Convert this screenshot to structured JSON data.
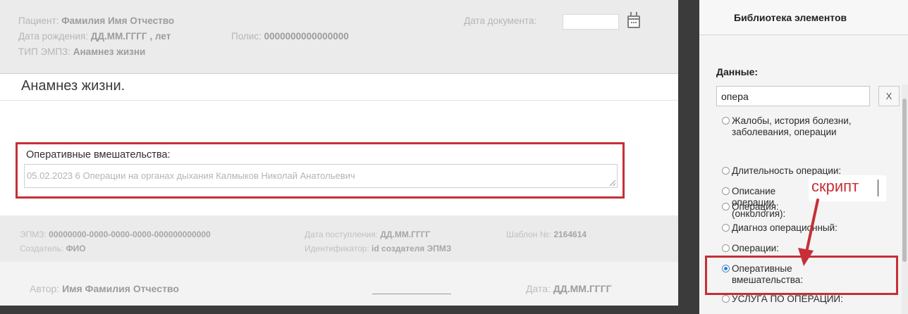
{
  "document": {
    "patient_label": "Пациент:",
    "patient_value": "Фамилия Имя Отчество",
    "birth_label": "Дата рождения:",
    "birth_value": "ДД.ММ.ГГГГ , лет",
    "policy_label": "Полис:",
    "policy_value": "0000000000000000",
    "type_label": "ТИП ЭМПЗ:",
    "type_value": "Анамнез жизни",
    "doc_date_label": "Дата документа:",
    "doc_date_value": "",
    "section_title": "Анамнез жизни.",
    "field_label": "Оперативные вмешательства:",
    "field_value": "05.02.2023 6 Операции на органах дыхания Калмыков Николай Анатольевич"
  },
  "footer": {
    "emz_label": "ЭПМЗ:",
    "emz_value": "00000000-0000-0000-0000-000000000000",
    "creator_label": "Создатель:",
    "creator_value": "ФИО",
    "received_label": "Дата поступления:",
    "received_value": "ДД.ММ.ГГГГ",
    "identifier_label": "Идентификатор:",
    "identifier_value": "id создателя ЭПМЗ",
    "template_label": "Шаблон №:",
    "template_value": "2164614",
    "author_label": "Автор:",
    "author_value": "Имя Фамилия Отчество",
    "date_label": "Дата:",
    "date_value": "ДД.ММ.ГГГГ"
  },
  "library": {
    "title": "Библиотека элементов",
    "section": "Данные:",
    "search_value": "опера",
    "clear_label": "X",
    "items": [
      {
        "label": "Жалобы, история болезни, заболевания, операции",
        "selected": false
      },
      {
        "label": "Длительность операции:",
        "selected": false
      },
      {
        "label": "Описание операции (онкология):",
        "selected": false
      },
      {
        "label": "Операция:",
        "selected": false
      },
      {
        "label": "Диагноз операционный:",
        "selected": false
      },
      {
        "label": "Операции:",
        "selected": false
      },
      {
        "label": "Оперативные вмешательства:",
        "selected": true
      },
      {
        "label": "УСЛУГА ПО ОПЕРАЦИИ:",
        "selected": false
      }
    ]
  },
  "annotation": {
    "script_label": "скрипт"
  },
  "colors": {
    "highlight": "#c62f36",
    "radio_selected": "#3179d9"
  }
}
